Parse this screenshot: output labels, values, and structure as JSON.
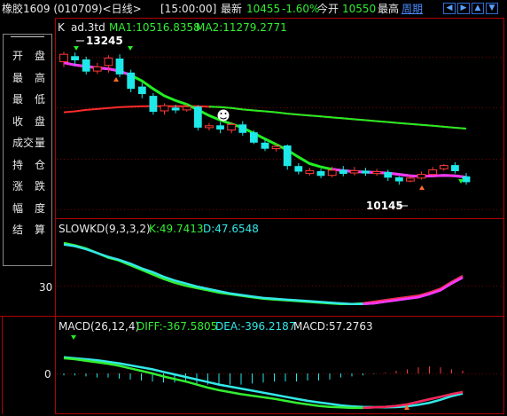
{
  "header": {
    "title": "橡胶1609 (010709)<日线>",
    "time": "[15:00:00]",
    "latest_label": "最新",
    "latest_value": "10455",
    "change": "-1.60%",
    "open_label": "今开",
    "open_value": "10550",
    "high_label": "最高",
    "period_link": "周期"
  },
  "nav_buttons": [
    "left-arrow",
    "right-arrow",
    "up-arrow",
    "down-arrow"
  ],
  "side_panel": {
    "top_dash": "------",
    "rows": [
      {
        "l": "开",
        "r": "盘"
      },
      {
        "l": "最",
        "r": "高"
      },
      {
        "l": "最",
        "r": "低"
      },
      {
        "l": "收",
        "r": "盘"
      },
      {
        "l": "成交",
        "r": "量"
      },
      {
        "l": "持",
        "r": "仓"
      },
      {
        "l": "涨",
        "r": "跌"
      },
      {
        "l": "幅",
        "r": "度"
      },
      {
        "l": "结",
        "r": "算"
      }
    ]
  },
  "main_legend": {
    "k": "K",
    "name": "ad.3td",
    "ma1": "MA1:10516.8358",
    "ma2": "MA2:11279.2771"
  },
  "main_annotations": {
    "high": "13245",
    "low": "10145",
    "face_icon": "smiley-face"
  },
  "kd_legend": {
    "name": "SLOWKD(9,3,3,2)",
    "k": "K:49.7413",
    "d": "D:47.6548",
    "axis_label": "30"
  },
  "macd_legend": {
    "name": "MACD(26,12,4)",
    "diff": "DIFF:-367.5805",
    "dea": "DEA:-396.2187",
    "macd": "MACD:57.2763",
    "axis_label": "0"
  },
  "colors": {
    "up": "#ff3a3a",
    "down": "#1ee8e8",
    "ma1": "#22ee22",
    "ma2": "#22ee22",
    "kd_k": "#33ee33",
    "kd_d": "#33e8e8",
    "kd_up_k": "#ff2060",
    "kd_up_d": "#ff33ff",
    "grid": "#7a0000",
    "frame": "#b00000"
  },
  "chart_data": [
    {
      "type": "candlestick",
      "title": "K ad.3td",
      "y_high_label": 13245,
      "y_low_label": 10145,
      "candles": [
        {
          "o": 13030,
          "c": 13190,
          "h": 13245,
          "l": 12920
        },
        {
          "o": 13150,
          "c": 13060,
          "h": 13230,
          "l": 12960
        },
        {
          "o": 13080,
          "c": 12820,
          "h": 13140,
          "l": 12760
        },
        {
          "o": 12830,
          "c": 12920,
          "h": 13010,
          "l": 12770
        },
        {
          "o": 12950,
          "c": 13110,
          "h": 13170,
          "l": 12800
        },
        {
          "o": 13100,
          "c": 12760,
          "h": 13190,
          "l": 12700
        },
        {
          "o": 12800,
          "c": 12450,
          "h": 12860,
          "l": 12380
        },
        {
          "o": 12500,
          "c": 12340,
          "h": 12580,
          "l": 12250
        },
        {
          "o": 12300,
          "c": 11960,
          "h": 12360,
          "l": 11900
        },
        {
          "o": 11980,
          "c": 12090,
          "h": 12140,
          "l": 11900
        },
        {
          "o": 12050,
          "c": 11990,
          "h": 12110,
          "l": 11930
        },
        {
          "o": 12000,
          "c": 12070,
          "h": 12120,
          "l": 11960
        },
        {
          "o": 12070,
          "c": 11620,
          "h": 12100,
          "l": 11560
        },
        {
          "o": 11620,
          "c": 11660,
          "h": 11720,
          "l": 11560
        },
        {
          "o": 11670,
          "c": 11580,
          "h": 11740,
          "l": 11500
        },
        {
          "o": 11570,
          "c": 11690,
          "h": 11740,
          "l": 11500
        },
        {
          "o": 11690,
          "c": 11510,
          "h": 11760,
          "l": 11450
        },
        {
          "o": 11520,
          "c": 11300,
          "h": 11560,
          "l": 11270
        },
        {
          "o": 11300,
          "c": 11170,
          "h": 11360,
          "l": 11120
        },
        {
          "o": 11170,
          "c": 11220,
          "h": 11270,
          "l": 11110
        },
        {
          "o": 11240,
          "c": 10800,
          "h": 11260,
          "l": 10720
        },
        {
          "o": 10800,
          "c": 10680,
          "h": 10860,
          "l": 10620
        },
        {
          "o": 10640,
          "c": 10700,
          "h": 10760,
          "l": 10600
        },
        {
          "o": 10690,
          "c": 10590,
          "h": 10740,
          "l": 10540
        },
        {
          "o": 10600,
          "c": 10710,
          "h": 10790,
          "l": 10560
        },
        {
          "o": 10720,
          "c": 10630,
          "h": 10800,
          "l": 10580
        },
        {
          "o": 10650,
          "c": 10700,
          "h": 10780,
          "l": 10600
        },
        {
          "o": 10700,
          "c": 10640,
          "h": 10760,
          "l": 10590
        },
        {
          "o": 10640,
          "c": 10680,
          "h": 10740,
          "l": 10590
        },
        {
          "o": 10670,
          "c": 10550,
          "h": 10720,
          "l": 10480
        },
        {
          "o": 10560,
          "c": 10470,
          "h": 10580,
          "l": 10400
        },
        {
          "o": 10480,
          "c": 10540,
          "h": 10600,
          "l": 10450
        },
        {
          "o": 10540,
          "c": 10620,
          "h": 10680,
          "l": 10510
        },
        {
          "o": 10620,
          "c": 10720,
          "h": 10780,
          "l": 10600
        },
        {
          "o": 10740,
          "c": 10810,
          "h": 10840,
          "l": 10700
        },
        {
          "o": 10820,
          "c": 10690,
          "h": 10880,
          "l": 10640
        },
        {
          "o": 10580,
          "c": 10455,
          "h": 10650,
          "l": 10400
        }
      ],
      "ma1": [
        13010,
        12960,
        12930,
        12900,
        12880,
        12830,
        12740,
        12620,
        12450,
        12300,
        12200,
        12120,
        12000,
        11880,
        11780,
        11700,
        11620,
        11500,
        11380,
        11260,
        11140,
        10990,
        10850,
        10780,
        10730,
        10700,
        10680,
        10670,
        10660,
        10650,
        10620,
        10590,
        10580,
        10590,
        10600,
        10590,
        10560
      ],
      "ma2": [
        11950,
        11970,
        12000,
        12020,
        12040,
        12060,
        12070,
        12080,
        12080,
        12080,
        12080,
        12080,
        12080,
        12070,
        12060,
        12040,
        12010,
        11990,
        11970,
        11950,
        11920,
        11900,
        11880,
        11860,
        11840,
        11820,
        11800,
        11780,
        11760,
        11740,
        11720,
        11700,
        11680,
        11660,
        11640,
        11620,
        11600
      ]
    },
    {
      "type": "line",
      "title": "SLOWKD(9,3,3,2)",
      "series": [
        {
          "name": "K",
          "values": [
            93,
            90,
            86,
            80,
            74,
            70,
            64,
            58,
            52,
            46,
            41,
            37,
            34,
            31,
            28,
            26,
            24,
            22,
            20,
            19,
            18,
            17,
            16,
            15,
            14,
            13,
            13,
            14,
            16,
            18,
            20,
            22,
            24,
            28,
            33,
            42,
            49.7413
          ]
        },
        {
          "name": "D",
          "values": [
            91,
            89,
            85,
            80,
            75,
            71,
            66,
            60,
            55,
            49,
            44,
            40,
            36,
            33,
            30,
            27,
            25,
            23,
            21,
            20,
            19,
            18,
            17,
            16,
            15,
            14,
            13,
            13,
            14,
            16,
            18,
            20,
            22,
            26,
            31,
            40,
            47.6548
          ]
        }
      ]
    },
    {
      "type": "line",
      "title": "MACD(26,12,4)",
      "series": [
        {
          "name": "DIFF",
          "values": [
            300,
            280,
            250,
            220,
            190,
            150,
            100,
            50,
            0,
            -60,
            -110,
            -160,
            -220,
            -280,
            -330,
            -370,
            -410,
            -440,
            -470,
            -500,
            -540,
            -580,
            -610,
            -640,
            -660,
            -670,
            -680,
            -680,
            -670,
            -660,
            -640,
            -610,
            -560,
            -510,
            -460,
            -410,
            -367.5805
          ]
        },
        {
          "name": "DEA",
          "values": [
            320,
            300,
            280,
            260,
            230,
            200,
            160,
            120,
            80,
            30,
            -20,
            -70,
            -120,
            -170,
            -220,
            -260,
            -300,
            -340,
            -380,
            -420,
            -460,
            -500,
            -540,
            -570,
            -600,
            -630,
            -650,
            -660,
            -665,
            -668,
            -665,
            -650,
            -620,
            -580,
            -520,
            -450,
            -396.2187
          ]
        }
      ]
    }
  ]
}
